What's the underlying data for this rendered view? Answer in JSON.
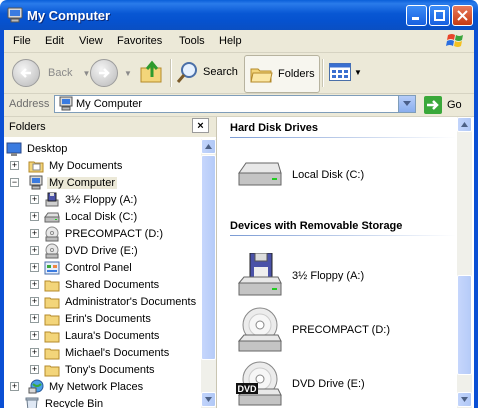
{
  "window": {
    "title": "My Computer"
  },
  "menu": [
    "File",
    "Edit",
    "View",
    "Favorites",
    "Tools",
    "Help"
  ],
  "toolbar": {
    "back": "Back",
    "search": "Search",
    "folders": "Folders"
  },
  "address": {
    "label": "Address",
    "value": "My Computer",
    "go": "Go"
  },
  "folders_pane": {
    "title": "Folders",
    "close": "×",
    "tree": [
      {
        "label": "Desktop",
        "icon": "desktop-icon",
        "expander": ""
      },
      {
        "label": "My Documents",
        "icon": "my-documents-folder-icon",
        "expander": "+"
      },
      {
        "label": "My Computer",
        "icon": "my-computer-icon",
        "expander": "−"
      },
      {
        "label": "3½ Floppy (A:)",
        "icon": "floppy-drive-icon",
        "expander": "+"
      },
      {
        "label": "Local Disk (C:)",
        "icon": "hard-disk-icon",
        "expander": "+"
      },
      {
        "label": "PRECOMPACT (D:)",
        "icon": "cd-drive-icon",
        "expander": "+"
      },
      {
        "label": "DVD Drive (E:)",
        "icon": "dvd-drive-icon",
        "expander": "+"
      },
      {
        "label": "Control Panel",
        "icon": "control-panel-icon",
        "expander": "+"
      },
      {
        "label": "Shared Documents",
        "icon": "folder-icon",
        "expander": "+"
      },
      {
        "label": "Administrator's Documents",
        "icon": "folder-icon",
        "expander": "+"
      },
      {
        "label": "Erin's Documents",
        "icon": "folder-icon",
        "expander": "+"
      },
      {
        "label": "Laura's Documents",
        "icon": "folder-icon",
        "expander": "+"
      },
      {
        "label": "Michael's Documents",
        "icon": "folder-icon",
        "expander": "+"
      },
      {
        "label": "Tony's Documents",
        "icon": "folder-icon",
        "expander": "+"
      },
      {
        "label": "My Network Places",
        "icon": "network-places-icon",
        "expander": "+"
      },
      {
        "label": "Recycle Bin",
        "icon": "recycle-bin-icon",
        "expander": ""
      }
    ]
  },
  "main": {
    "groups": [
      {
        "title": "Hard Disk Drives",
        "items": [
          {
            "label": "Local Disk (C:)",
            "icon": "hard-disk-icon"
          }
        ]
      },
      {
        "title": "Devices with Removable Storage",
        "items": [
          {
            "label": "3½ Floppy (A:)",
            "icon": "floppy-drive-icon"
          },
          {
            "label": "PRECOMPACT (D:)",
            "icon": "cd-drive-icon"
          },
          {
            "label": "DVD Drive (E:)",
            "icon": "dvd-drive-icon",
            "badge": "DVD"
          }
        ]
      }
    ]
  },
  "colors": {
    "titlebar": "#0a5fd8",
    "chrome": "#ece9d8",
    "group_line": "#7b9bd4"
  }
}
